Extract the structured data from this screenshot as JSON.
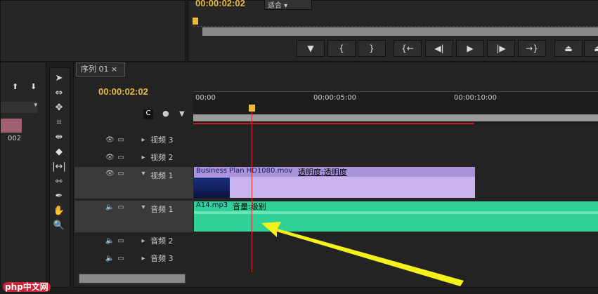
{
  "program": {
    "timecode": "00:00:02:02",
    "fit": "适合",
    "buttons": [
      "marker",
      "mark-in",
      "mark-out",
      "go-to-in",
      "step-back",
      "play",
      "step-forward",
      "go-to-out",
      "lift",
      "extract"
    ]
  },
  "sequence": {
    "tab": "序列 01",
    "timecode": "00:00:02:02",
    "ruler": [
      "00:00",
      "00:00:05:00",
      "00:00:10:00"
    ],
    "tracks": [
      {
        "name": "视频 3"
      },
      {
        "name": "视频 2"
      },
      {
        "name": "视频 1"
      },
      {
        "name": "音频 1"
      },
      {
        "name": "音频 2"
      },
      {
        "name": "音频 3"
      }
    ],
    "video_clip": {
      "name": "Business Plan HD1080.mov",
      "fx": "透明度:透明度"
    },
    "audio_clip": {
      "name": "A14.mp3",
      "fx": "音量:级别"
    }
  },
  "project": {
    "item": "002"
  },
  "watermark": "php中文网",
  "colors": {
    "accent": "#e8b93a",
    "playhead": "#d03030",
    "video": "#b9a4e6",
    "audio": "#2fd197",
    "arrow": "#f4f21a"
  }
}
